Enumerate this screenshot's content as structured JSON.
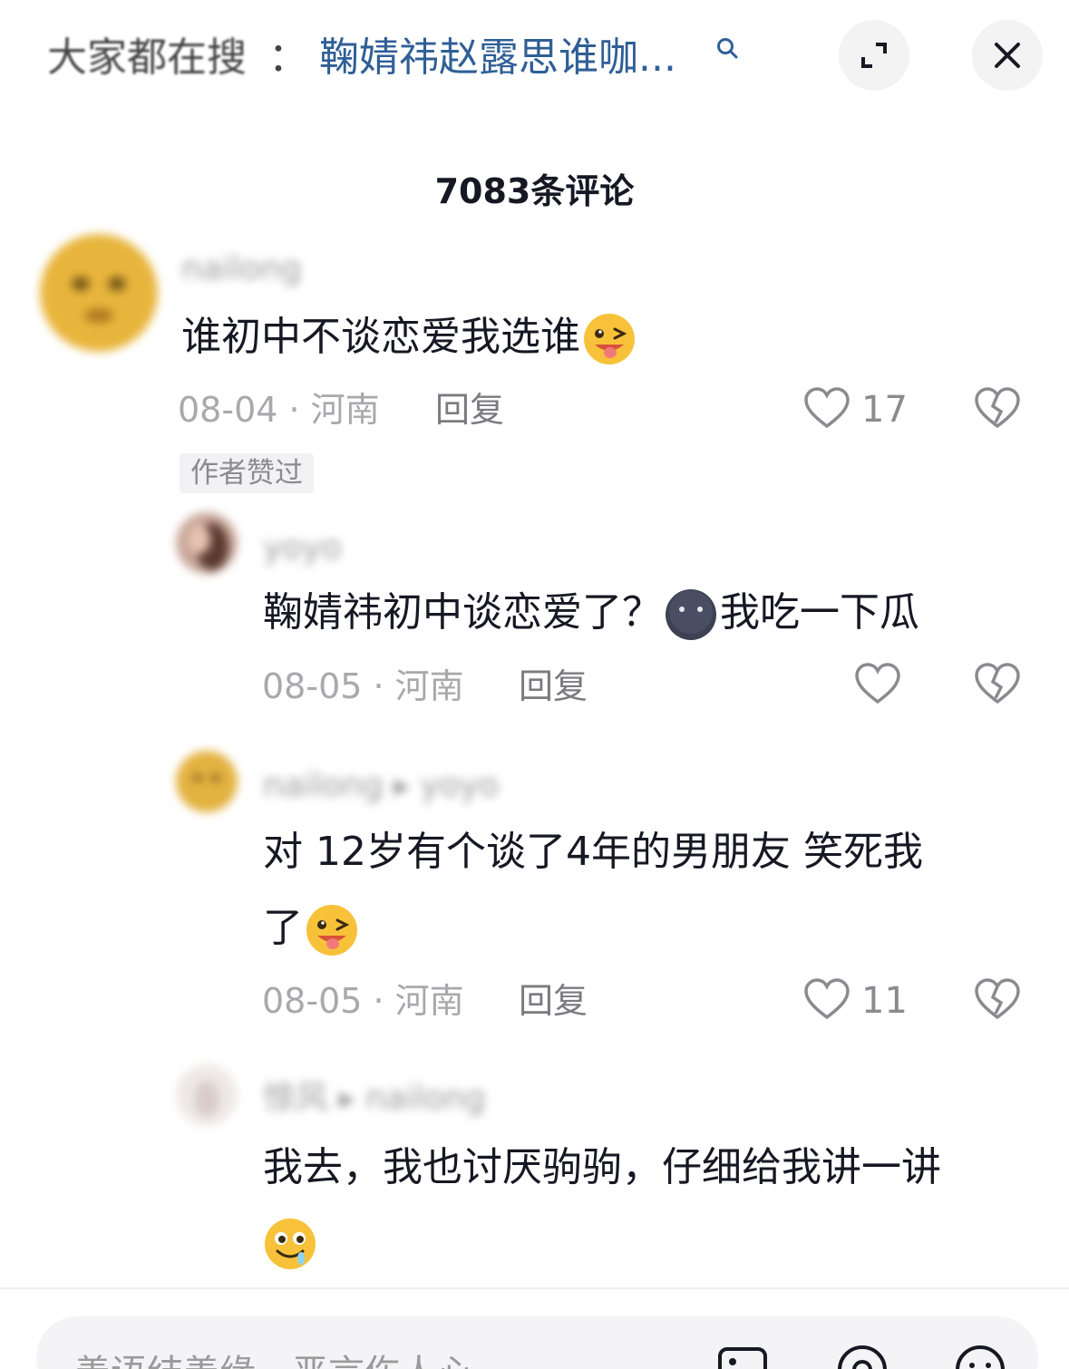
{
  "header": {
    "search_prefix": "大家都在搜",
    "search_colon": "：",
    "search_query": "鞠婧祎赵露思谁咖...",
    "icons": [
      "search-icon",
      "expand-icon",
      "close-icon"
    ]
  },
  "comment_count": "7083条评论",
  "comments": [
    {
      "username": "nailong",
      "text_before": "谁初中不谈恋爱我选谁",
      "emoji": "wink-tongue-emoji",
      "date_location": "08-04 · 河南",
      "reply_label": "回复",
      "likes": "17",
      "badge": "作者赞过"
    },
    {
      "username": "yoyo",
      "text_before": "鞠婧祎初中谈恋爱了？",
      "emoji": "dark-face-emoji",
      "text_after": "我吃一下瓜",
      "date_location": "08-05 · 河南",
      "reply_label": "回复",
      "likes": ""
    },
    {
      "username": "nailong ▸ yoyo",
      "text_line1": "对 12岁有个谈了4年的男朋友 笑死我",
      "text_line2": "了",
      "emoji": "wink-tongue-emoji",
      "date_location": "08-05 · 河南",
      "reply_label": "回复",
      "likes": "11"
    },
    {
      "username": "惊风 ▸ nailong",
      "text_line1": "我去，我也讨厌驹驹，仔细给我讲一讲",
      "emoji": "drool-emoji"
    }
  ],
  "input": {
    "placeholder": "善语结善缘，恶言伤人心",
    "icons": [
      "image-icon",
      "at-icon",
      "emoji-icon"
    ]
  },
  "colors": {
    "query_blue": "#2f5f96",
    "meta_gray": "#a8a8ad",
    "text_dark": "#161823"
  }
}
